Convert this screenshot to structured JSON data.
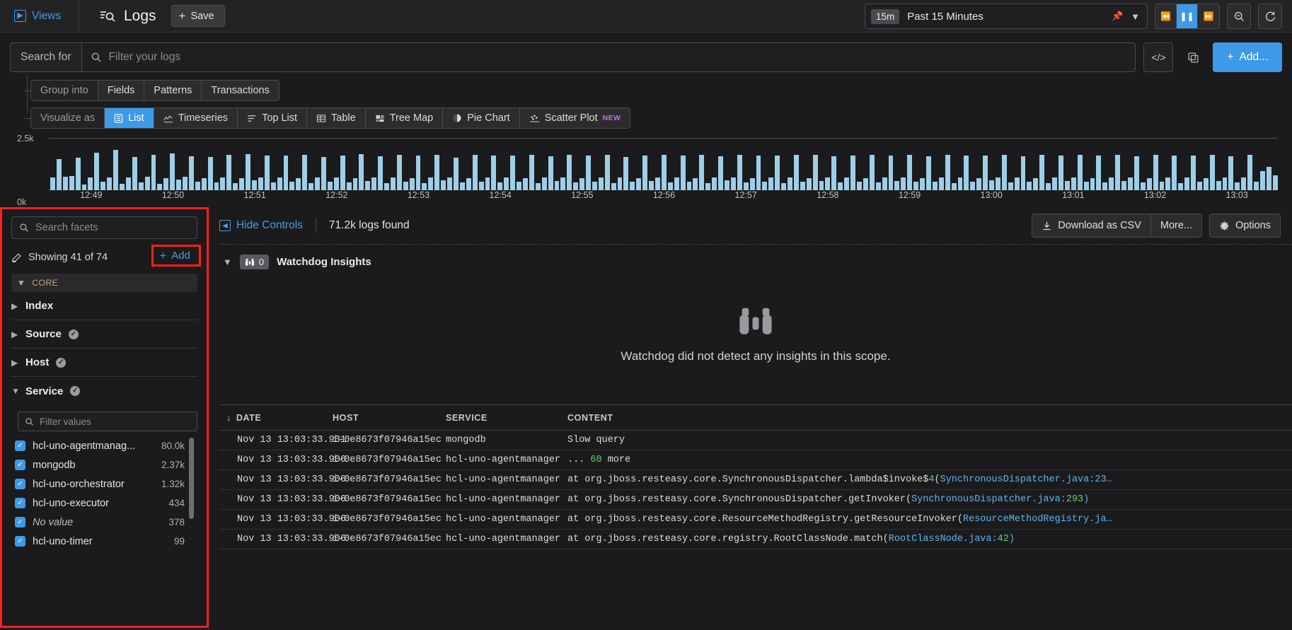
{
  "topbar": {
    "views_label": "Views",
    "views_icon": "views-panel-icon",
    "logs_title": "Logs",
    "save_label": "Save",
    "time": {
      "badge": "15m",
      "text": "Past 15 Minutes",
      "pin_icon": "pin-icon",
      "chevron_icon": "chevron-down-icon"
    },
    "playback": {
      "rewind_icon": "rewind-icon",
      "pause_icon": "pause-icon",
      "forward_icon": "fast-forward-icon"
    },
    "zoom_out_icon": "zoom-out-icon",
    "refresh_icon": "refresh-icon"
  },
  "search": {
    "label": "Search for",
    "placeholder": "Filter your logs",
    "value": "",
    "search_icon": "search-icon",
    "code_icon": "code-brackets-icon",
    "copy_icon": "copy-icon",
    "add_label": "Add..."
  },
  "group_into": {
    "label": "Group into",
    "options": [
      "Fields",
      "Patterns",
      "Transactions"
    ],
    "selected": ""
  },
  "visualize_as": {
    "label": "Visualize as",
    "options": [
      {
        "label": "List",
        "icon": "list-icon",
        "active": true,
        "badge": ""
      },
      {
        "label": "Timeseries",
        "icon": "timeseries-icon",
        "active": false,
        "badge": ""
      },
      {
        "label": "Top List",
        "icon": "top-list-icon",
        "active": false,
        "badge": ""
      },
      {
        "label": "Table",
        "icon": "table-icon",
        "active": false,
        "badge": ""
      },
      {
        "label": "Tree Map",
        "icon": "tree-map-icon",
        "active": false,
        "badge": ""
      },
      {
        "label": "Pie Chart",
        "icon": "pie-chart-icon",
        "active": false,
        "badge": ""
      },
      {
        "label": "Scatter Plot",
        "icon": "scatter-plot-icon",
        "active": false,
        "badge": "NEW"
      }
    ]
  },
  "chart_data": {
    "type": "bar",
    "title": "",
    "xlabel": "",
    "ylabel": "",
    "ylim": [
      0,
      2500
    ],
    "ytick_labels": [
      "2.5k",
      "0k"
    ],
    "grid": true,
    "legend": "none",
    "xtick_labels": [
      "12:49",
      "12:50",
      "12:51",
      "12:52",
      "12:53",
      "12:54",
      "12:55",
      "12:56",
      "12:57",
      "12:58",
      "12:59",
      "13:00",
      "13:01",
      "13:02",
      "13:03"
    ],
    "bar_color": "#9dcfe8",
    "values": [
      620,
      1500,
      640,
      660,
      1540,
      260,
      600,
      1780,
      420,
      600,
      1920,
      300,
      620,
      1600,
      380,
      640,
      1680,
      320,
      560,
      1760,
      500,
      640,
      1620,
      420,
      580,
      1600,
      360,
      600,
      1700,
      330,
      560,
      1720,
      480,
      620,
      1640,
      360,
      600,
      1660,
      400,
      580,
      1700,
      330,
      620,
      1580,
      420,
      600,
      1660,
      380,
      560,
      1720,
      440,
      600,
      1620,
      350,
      620,
      1680,
      400,
      580,
      1640,
      330,
      600,
      1700,
      460,
      620,
      1560,
      380,
      560,
      1700,
      420,
      600,
      1640,
      360,
      620,
      1660,
      400,
      560,
      1700,
      340,
      600,
      1620,
      450,
      620,
      1680,
      380,
      580,
      1640,
      420,
      600,
      1700,
      330,
      620,
      1580,
      400,
      560,
      1660,
      430,
      600,
      1700,
      360,
      620,
      1640,
      400,
      580,
      1680,
      340,
      600,
      1620,
      460,
      620,
      1700,
      380,
      560,
      1660,
      420,
      600,
      1640,
      350,
      620,
      1680,
      400,
      580,
      1700,
      430,
      600,
      1620,
      370,
      620,
      1660,
      410,
      560,
      1700,
      360,
      600,
      1640,
      440,
      620,
      1680,
      390,
      580,
      1620,
      420,
      600,
      1700,
      350,
      620,
      1660,
      400,
      560,
      1640,
      460,
      600,
      1700,
      380,
      620,
      1620,
      410,
      580,
      1680,
      340,
      600,
      1660,
      430,
      620,
      1700,
      400,
      560,
      1640,
      370,
      600,
      1680,
      450,
      620,
      1620,
      380,
      580,
      1700,
      420,
      600,
      1660,
      340,
      620,
      1640,
      400,
      560,
      1700,
      430,
      600,
      1620,
      370,
      620,
      1680,
      410,
      900,
      1100,
      700
    ]
  },
  "facets": {
    "search_placeholder": "Search facets",
    "search_value": "",
    "search_icon": "search-icon",
    "showing_text": "Showing 41 of 74",
    "edit_icon": "pencil-icon",
    "add_label": "Add",
    "group_label": "CORE",
    "items": [
      {
        "label": "Index",
        "expanded": false,
        "checked": false
      },
      {
        "label": "Source",
        "expanded": false,
        "checked": true
      },
      {
        "label": "Host",
        "expanded": false,
        "checked": true
      },
      {
        "label": "Service",
        "expanded": true,
        "checked": true
      }
    ],
    "values_placeholder": "Filter values",
    "values_value": "",
    "values": [
      {
        "name": "hcl-uno-agentmanag...",
        "count": "80.0k",
        "checked": true,
        "no_value": false
      },
      {
        "name": "mongodb",
        "count": "2.37k",
        "checked": true,
        "no_value": false
      },
      {
        "name": "hcl-uno-orchestrator",
        "count": "1.32k",
        "checked": true,
        "no_value": false
      },
      {
        "name": "hcl-uno-executor",
        "count": "434",
        "checked": true,
        "no_value": false
      },
      {
        "name": "No value",
        "count": "378",
        "checked": true,
        "no_value": true
      },
      {
        "name": "hcl-uno-timer",
        "count": "99",
        "checked": true,
        "no_value": false
      }
    ]
  },
  "main": {
    "hide_controls_label": "Hide Controls",
    "hide_controls_icon": "collapse-panel-icon",
    "logs_found": "71.2k logs found",
    "download_label": "Download as CSV",
    "download_icon": "download-icon",
    "more_label": "More...",
    "options_label": "Options",
    "options_icon": "gear-icon"
  },
  "watchdog": {
    "chevron_icon": "chevron-down-icon",
    "count": "0",
    "binoculars_icon": "binoculars-icon",
    "title": "Watchdog Insights",
    "empty_text": "Watchdog did not detect any insights in this scope."
  },
  "logtable": {
    "sort_icon": "sort-desc-arrow-icon",
    "columns": [
      "DATE",
      "HOST",
      "SERVICE",
      "CONTENT"
    ],
    "rows": [
      {
        "date": "Nov 13 13:03:33.931",
        "host": "i-0e8673f07946a15ec",
        "service": "mongodb",
        "content_plain": "Slow query",
        "content_parts": [
          {
            "t": "Slow query",
            "c": "plain"
          }
        ]
      },
      {
        "date": "Nov 13 13:03:33.906",
        "host": "i-0e8673f07946a15ec",
        "service": "hcl-uno-agentmanager",
        "content_plain": "... 60 more",
        "content_parts": [
          {
            "t": "... ",
            "c": "plain"
          },
          {
            "t": "60",
            "c": "green"
          },
          {
            "t": " more",
            "c": "plain"
          }
        ]
      },
      {
        "date": "Nov 13 13:03:33.906",
        "host": "i-0e8673f07946a15ec",
        "service": "hcl-uno-agentmanager",
        "content_plain": "at org.jboss.resteasy.core.SynchronousDispatcher.lambda$invoke$4(SynchronousDispatcher.java:23…",
        "content_parts": [
          {
            "t": "at org.jboss.resteasy.core.SynchronousDispatcher.lambda$invoke$",
            "c": "plain"
          },
          {
            "t": "4",
            "c": "green"
          },
          {
            "t": "(",
            "c": "plain"
          },
          {
            "t": "SynchronousDispatcher.java:23…",
            "c": "blue"
          }
        ]
      },
      {
        "date": "Nov 13 13:03:33.906",
        "host": "i-0e8673f07946a15ec",
        "service": "hcl-uno-agentmanager",
        "content_plain": "at org.jboss.resteasy.core.SynchronousDispatcher.getInvoker(SynchronousDispatcher.java:293)",
        "content_parts": [
          {
            "t": "at org.jboss.resteasy.core.SynchronousDispatcher.getInvoker(",
            "c": "plain"
          },
          {
            "t": "SynchronousDispatcher.java:",
            "c": "blue"
          },
          {
            "t": "293",
            "c": "green"
          },
          {
            "t": ")",
            "c": "blue"
          }
        ]
      },
      {
        "date": "Nov 13 13:03:33.906",
        "host": "i-0e8673f07946a15ec",
        "service": "hcl-uno-agentmanager",
        "content_plain": "at org.jboss.resteasy.core.ResourceMethodRegistry.getResourceInvoker(ResourceMethodRegistry.ja…",
        "content_parts": [
          {
            "t": "at org.jboss.resteasy.core.ResourceMethodRegistry.getResourceInvoker(",
            "c": "plain"
          },
          {
            "t": "ResourceMethodRegistry.ja…",
            "c": "blue"
          }
        ]
      },
      {
        "date": "Nov 13 13:03:33.906",
        "host": "i-0e8673f07946a15ec",
        "service": "hcl-uno-agentmanager",
        "content_plain": "at org.jboss.resteasy.core.registry.RootClassNode.match(RootClassNode.java:42)",
        "content_parts": [
          {
            "t": "at org.jboss.resteasy.core.registry.RootClassNode.match(",
            "c": "plain"
          },
          {
            "t": "RootClassNode.java:",
            "c": "blue"
          },
          {
            "t": "42",
            "c": "green"
          },
          {
            "t": ")",
            "c": "blue"
          }
        ]
      }
    ]
  }
}
